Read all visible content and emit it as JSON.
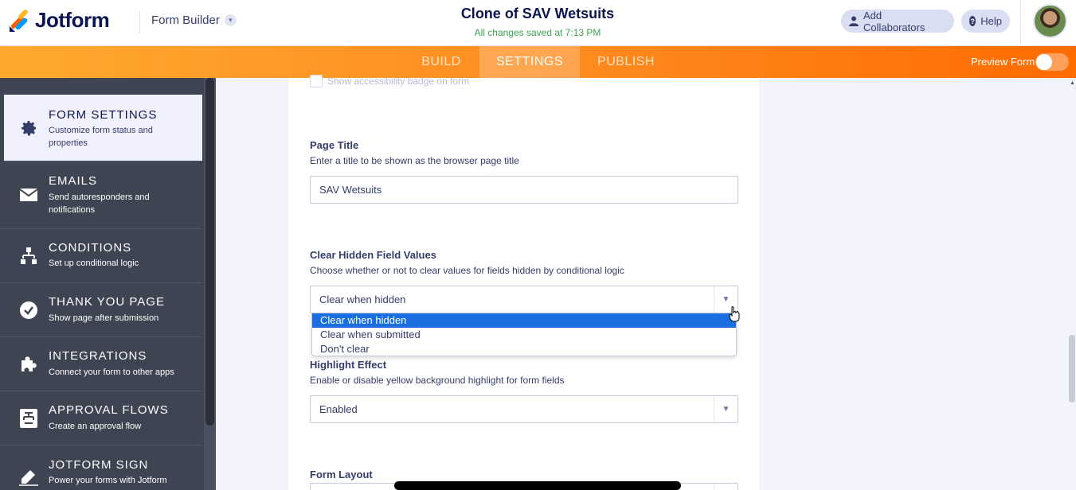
{
  "header": {
    "brand": "Jotform",
    "builder_label": "Form Builder",
    "form_title": "Clone of SAV Wetsuits",
    "saved_status": "All changes saved at 7:13 PM",
    "add_collaborators": "Add Collaborators",
    "help": "Help"
  },
  "nav": {
    "tabs": [
      {
        "label": "BUILD"
      },
      {
        "label": "SETTINGS"
      },
      {
        "label": "PUBLISH"
      }
    ],
    "active_tab": "SETTINGS",
    "preview_label": "Preview Form"
  },
  "sidebar": {
    "items": [
      {
        "title": "FORM SETTINGS",
        "desc": "Customize form status and properties",
        "icon": "gear-icon"
      },
      {
        "title": "EMAILS",
        "desc": "Send autoresponders and notifications",
        "icon": "envelope-icon"
      },
      {
        "title": "CONDITIONS",
        "desc": "Set up conditional logic",
        "icon": "flowchart-icon"
      },
      {
        "title": "THANK YOU PAGE",
        "desc": "Show page after submission",
        "icon": "check-circle-icon"
      },
      {
        "title": "INTEGRATIONS",
        "desc": "Connect your form to other apps",
        "icon": "puzzle-icon"
      },
      {
        "title": "APPROVAL FLOWS",
        "desc": "Create an approval flow",
        "icon": "approval-flow-icon"
      },
      {
        "title": "JOTFORM SIGN",
        "desc": "Power your forms with Jotform",
        "icon": "pen-icon"
      }
    ]
  },
  "main": {
    "accessibility_label": "Show accessibility badge on form",
    "page_title": {
      "label": "Page Title",
      "desc": "Enter a title to be shown as the browser page title",
      "value": "SAV Wetsuits"
    },
    "clear_hidden": {
      "label": "Clear Hidden Field Values",
      "desc": "Choose whether or not to clear values for fields hidden by conditional logic",
      "value": "Clear when hidden",
      "options": [
        "Clear when hidden",
        "Clear when submitted",
        "Don't clear"
      ]
    },
    "highlight": {
      "label": "Highlight Effect",
      "desc": "Enable or disable yellow background highlight for form fields",
      "value": "Enabled"
    },
    "form_layout": {
      "label": "Form Layout"
    }
  },
  "colors": {
    "brand_orange": "#ff8a1e",
    "sidebar_bg": "#3e4452",
    "selected_option": "#1a6ee0"
  }
}
